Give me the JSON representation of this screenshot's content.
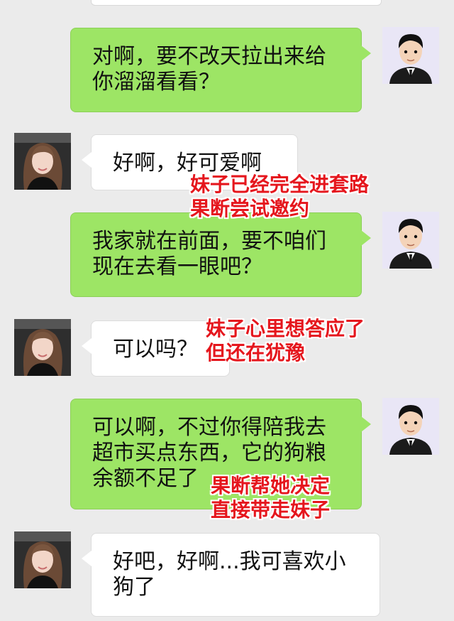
{
  "chat": {
    "messages": [
      {
        "sender": "me",
        "text": "对啊，要不改天拉出来给\n你溜溜看看？"
      },
      {
        "sender": "her",
        "text": "好啊，好可爱啊"
      },
      {
        "sender": "me",
        "text": "我家就在前面，要不咱们\n现在去看一眼吧？"
      },
      {
        "sender": "her",
        "text": "可以吗？"
      },
      {
        "sender": "me",
        "text": "可以啊，不过你得陪我去\n超市买点东西，它的狗粮\n余额不足了"
      },
      {
        "sender": "her",
        "text": "好吧，好啊...我可喜欢小\n狗了"
      }
    ]
  },
  "annotations": [
    "妹子已经完全进套路\n果断尝试邀约",
    "妹子心里想答应了\n但还在犹豫",
    "果断帮她决定\n直接带走妹子"
  ],
  "colors": {
    "my_bubble": "#9de565",
    "her_bubble": "#ffffff",
    "annotation": "#e5161d",
    "background": "#ebebeb"
  }
}
